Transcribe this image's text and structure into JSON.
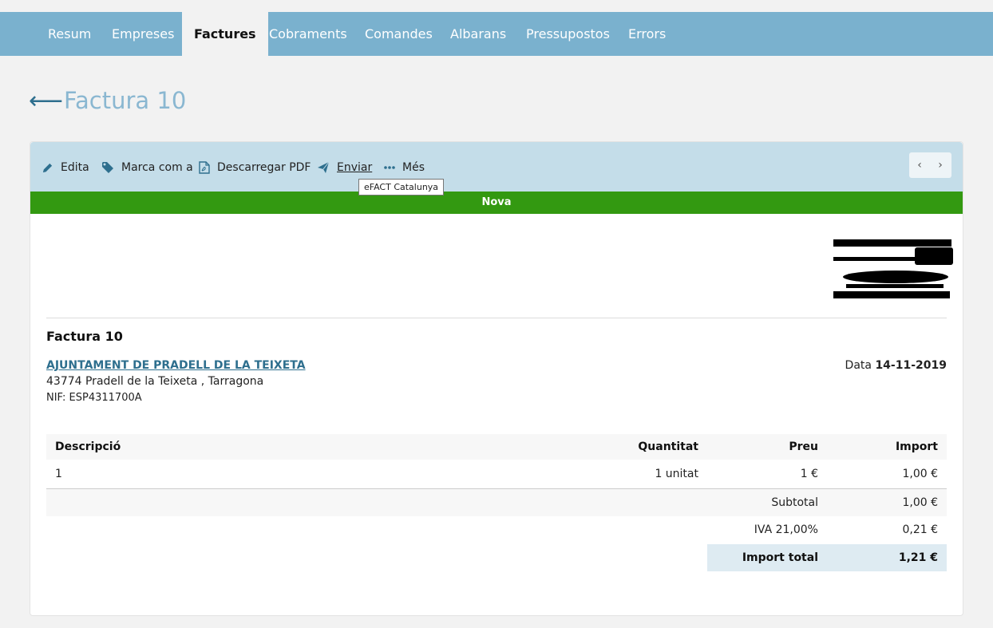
{
  "nav": {
    "items": [
      "Resum",
      "Empreses",
      "Factures",
      "Cobraments",
      "Comandes",
      "Albarans",
      "Pressupostos",
      "Errors"
    ],
    "active": "Factures"
  },
  "page": {
    "back_icon": "arrow-left-icon",
    "title": "Factura 10"
  },
  "toolbar": {
    "edit": "Edita",
    "mark": "Marca com a",
    "download": "Descarregar PDF",
    "send": "Enviar",
    "more": "Més",
    "tooltip": "eFACT Catalunya",
    "prev": "‹",
    "next": "›"
  },
  "status": {
    "label": "Nova",
    "color": "#339911"
  },
  "invoice": {
    "title": "Factura 10",
    "client_name": "AJUNTAMENT DE PRADELL DE LA TEIXETA",
    "client_address": "43774 Pradell de la Teixeta , Tarragona",
    "client_nif": "NIF: ESP4311700A",
    "date_label": "Data",
    "date_value": "14-11-2019"
  },
  "table": {
    "headers": {
      "description": "Descripció",
      "quantity": "Quantitat",
      "price": "Preu",
      "amount": "Import"
    },
    "rows": [
      {
        "description": "1",
        "quantity": "1 unitat",
        "price": "1 €",
        "amount": "1,00 €"
      }
    ],
    "subtotal_label": "Subtotal",
    "subtotal_value": "1,00 €",
    "tax_label": "IVA 21,00%",
    "tax_value": "0,21 €",
    "total_label": "Import total",
    "total_value": "1,21 €"
  },
  "colors": {
    "nav": "#7ab1ce",
    "toolbar": "#c4dde9",
    "accent": "#2e6f8e",
    "title": "#8ab7d1"
  }
}
